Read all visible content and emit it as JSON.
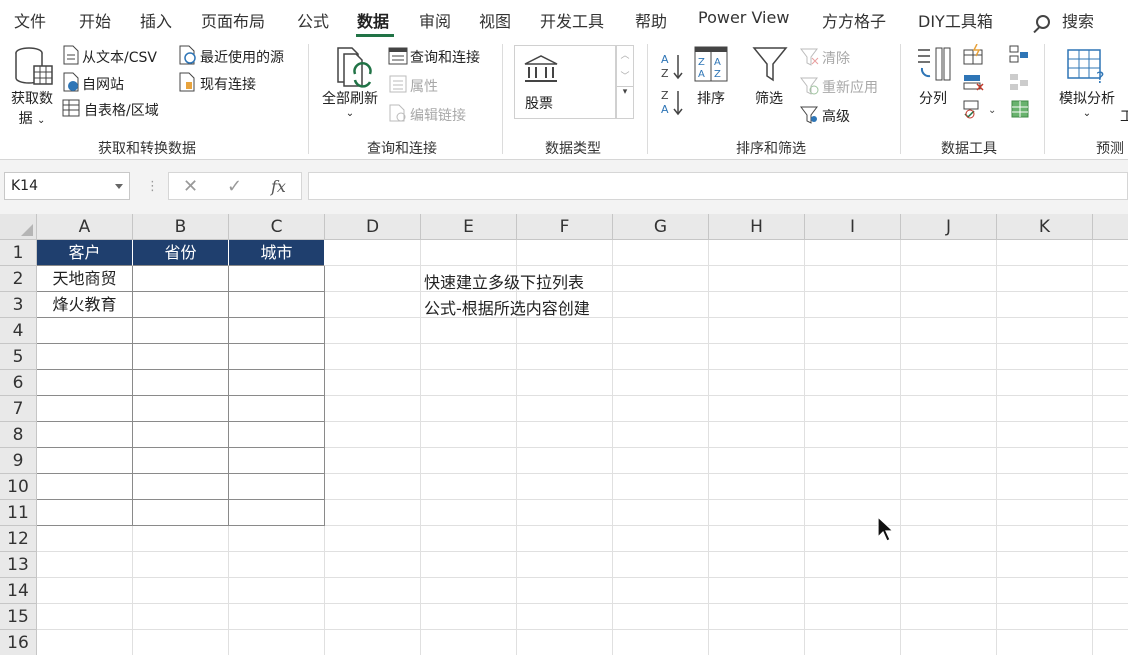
{
  "menu": {
    "tabs": [
      "文件",
      "开始",
      "插入",
      "页面布局",
      "公式",
      "数据",
      "审阅",
      "视图",
      "开发工具",
      "帮助",
      "Power View",
      "方方格子",
      "DIY工具箱"
    ],
    "active": "数据",
    "search": "搜索"
  },
  "ribbon": {
    "get_data": {
      "big_label_1": "获取数",
      "big_label_2": "据",
      "from_text": "从文本/CSV",
      "from_web": "自网站",
      "from_table": "自表格/区域",
      "recent": "最近使用的源",
      "existing": "现有连接",
      "group": "获取和转换数据"
    },
    "queries": {
      "refresh_all": "全部刷新",
      "queries_conn": "查询和连接",
      "properties": "属性",
      "edit_links": "编辑链接",
      "group": "查询和连接"
    },
    "data_types": {
      "stocks": "股票",
      "group": "数据类型"
    },
    "sort_filter": {
      "sort": "排序",
      "filter": "筛选",
      "clear": "清除",
      "reapply": "重新应用",
      "advanced": "高级",
      "group": "排序和筛选"
    },
    "data_tools": {
      "split": "分列",
      "group": "数据工具"
    },
    "forecast": {
      "whatif": "模拟分析",
      "group": "预测",
      "extra": "工"
    }
  },
  "formula_bar": {
    "name_box": "K14",
    "fx": "fx",
    "value": ""
  },
  "sheet": {
    "columns": [
      "A",
      "B",
      "C",
      "D",
      "E",
      "F",
      "G",
      "H",
      "I",
      "J",
      "K"
    ],
    "rows": [
      "1",
      "2",
      "3",
      "4",
      "5",
      "6",
      "7",
      "8",
      "9",
      "10",
      "11",
      "12",
      "13",
      "14",
      "15",
      "16"
    ],
    "table_headers": [
      "客户",
      "省份",
      "城市"
    ],
    "table_rows": [
      [
        "天地商贸",
        "",
        ""
      ],
      [
        "烽火教育",
        "",
        ""
      ]
    ],
    "notes": [
      "快速建立多级下拉列表",
      "公式-根据所选内容创建"
    ]
  },
  "colors": {
    "accent": "#217346",
    "table_header": "#1f3f6e"
  }
}
